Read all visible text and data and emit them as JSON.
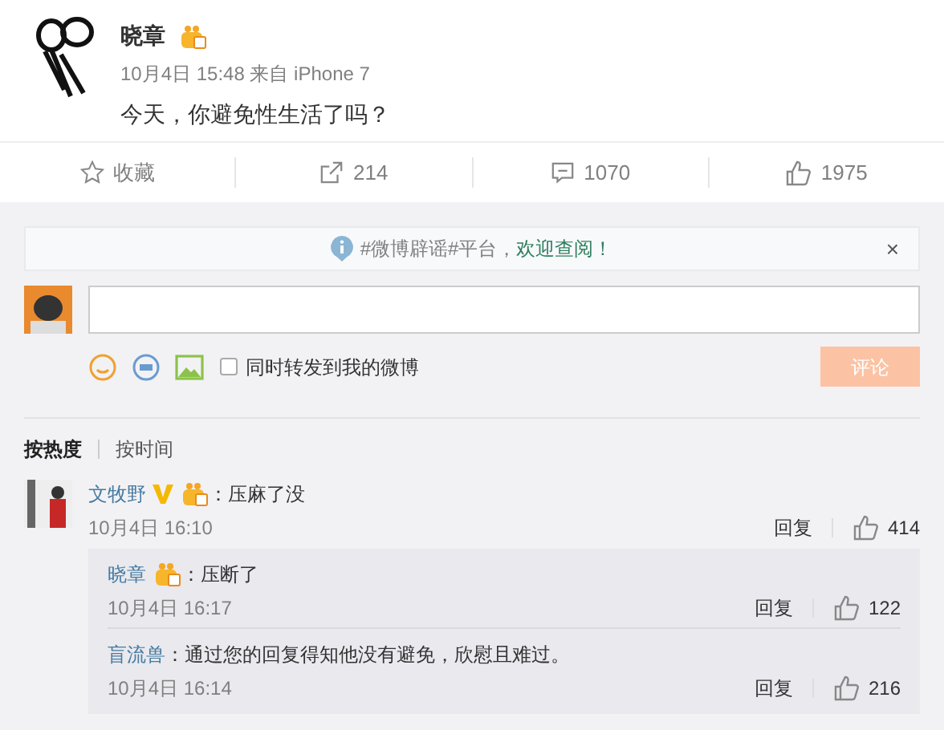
{
  "post": {
    "author": "晓章",
    "meta": "10月4日 15:48 来自 iPhone 7",
    "text": "今天，你避免性生活了吗？"
  },
  "actions": [
    {
      "kind": "star",
      "label": "收藏"
    },
    {
      "kind": "repost",
      "label": "214"
    },
    {
      "kind": "comment",
      "label": "1070"
    },
    {
      "kind": "like",
      "label": "1975"
    }
  ],
  "notice": {
    "tag": "#微博辟谣#平台，",
    "link": "欢迎查阅！",
    "close": "×"
  },
  "composer": {
    "share_label": "同时转发到我的微博",
    "share_checked": false,
    "submit": "评论",
    "submit_disabled": true
  },
  "sort_tabs": [
    {
      "label": "按热度",
      "selected": true
    },
    {
      "label": "按时间",
      "selected": false
    }
  ],
  "comments": [
    {
      "author": "文牧野",
      "verified": true,
      "text": "：压麻了没",
      "time": "10月4日 16:10",
      "reply": "回复",
      "likes": "414",
      "replies": [
        {
          "author": "晓章",
          "badge": true,
          "text": "：压断了",
          "time": "10月4日 16:17",
          "reply": "回复",
          "likes": "122"
        },
        {
          "author": "盲流兽",
          "badge": false,
          "text": "：通过您的回复得知他没有避免，欣慰且难过。",
          "time": "10月4日 16:14",
          "reply": "回复",
          "likes": "216"
        }
      ]
    }
  ]
}
